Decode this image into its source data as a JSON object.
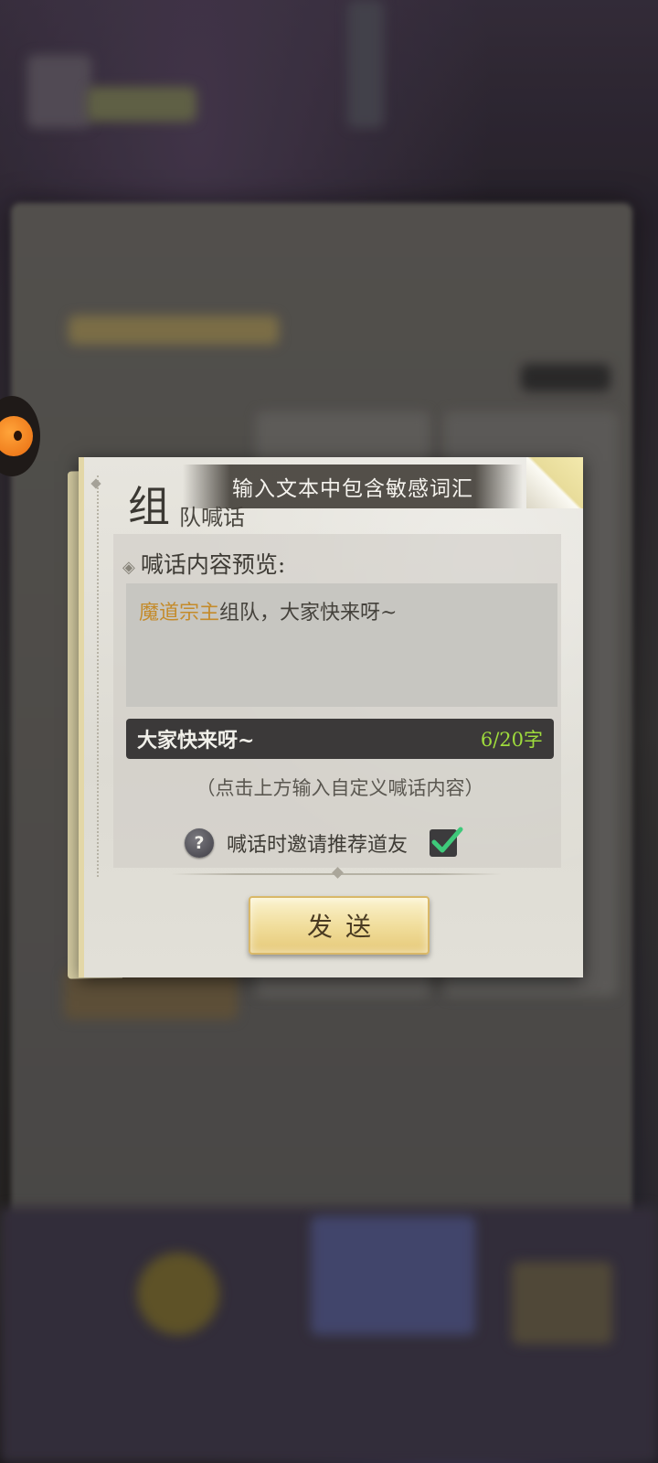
{
  "toast": {
    "message": "输入文本中包含敏感词汇"
  },
  "dialog": {
    "title_main": "组",
    "title_rest": "队喊话",
    "preview_label": "喊话内容预览:",
    "preview": {
      "highlight": "魔道宗主",
      "text": "组队，大家快来呀~"
    },
    "input": {
      "value": "大家快来呀~",
      "counter": "6/20字"
    },
    "hint": "（点击上方输入自定义喊话内容）",
    "invite": {
      "label": "喊话时邀请推荐道友",
      "checked": true
    },
    "send_label": "发送"
  },
  "icons": {
    "help": "question-icon",
    "check": "checkmark-icon"
  },
  "colors": {
    "highlight": "#c48b2b",
    "counter": "#9fdc3c",
    "check": "#3ec97a"
  }
}
